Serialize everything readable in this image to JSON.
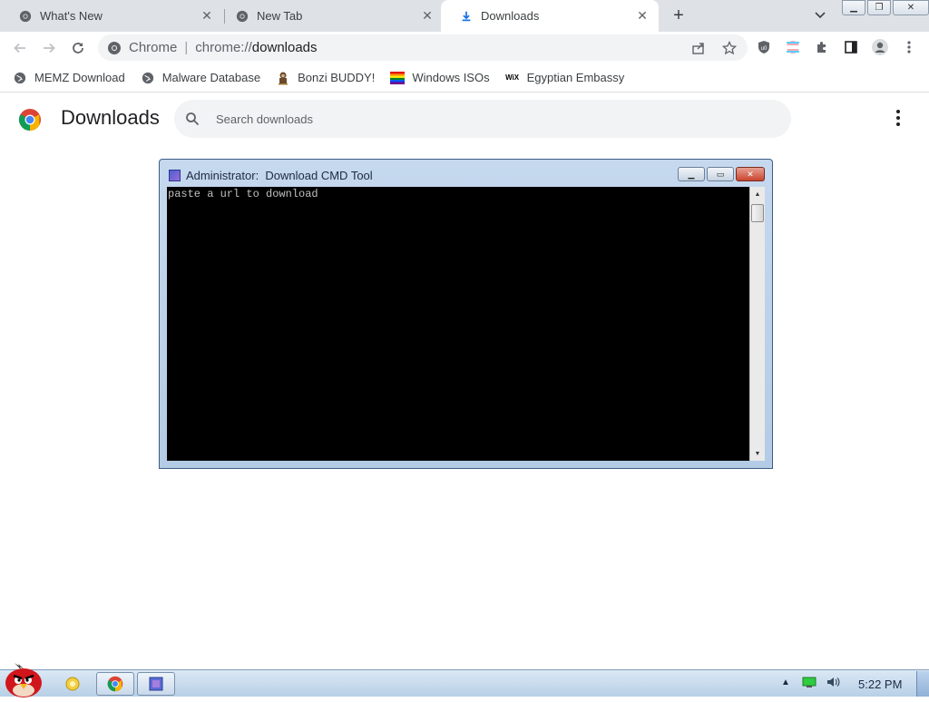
{
  "browser": {
    "tabs": [
      {
        "label": "What's New",
        "icon": "chrome-favicon-icon",
        "active": false
      },
      {
        "label": "New Tab",
        "icon": "chrome-favicon-icon",
        "active": false
      },
      {
        "label": "Downloads",
        "icon": "download-icon",
        "active": true
      }
    ],
    "omnibox": {
      "site_name": "Chrome",
      "url_scheme": "chrome://",
      "url_host": "downloads"
    },
    "bookmarks": [
      {
        "label": "MEMZ Download",
        "icon": "globe-icon"
      },
      {
        "label": "Malware Database",
        "icon": "globe-icon"
      },
      {
        "label": "Bonzi BUDDY!",
        "icon": "bonzi-icon"
      },
      {
        "label": "Windows ISOs",
        "icon": "rainbow-flag-icon"
      },
      {
        "label": "Egyptian Embassy",
        "icon": "wix-icon"
      }
    ]
  },
  "downloads_page": {
    "title": "Downloads",
    "search_placeholder": "Search downloads"
  },
  "cmd_window": {
    "title": "Administrator:  Download CMD Tool",
    "console_text": "paste a url to download"
  },
  "taskbar": {
    "clock": "5:22 PM"
  },
  "colors": {
    "tabstrip_bg": "#dee1e6",
    "accent_blue": "#1a73e8",
    "console_bg": "#000000",
    "console_fg": "#c0c0c0"
  }
}
